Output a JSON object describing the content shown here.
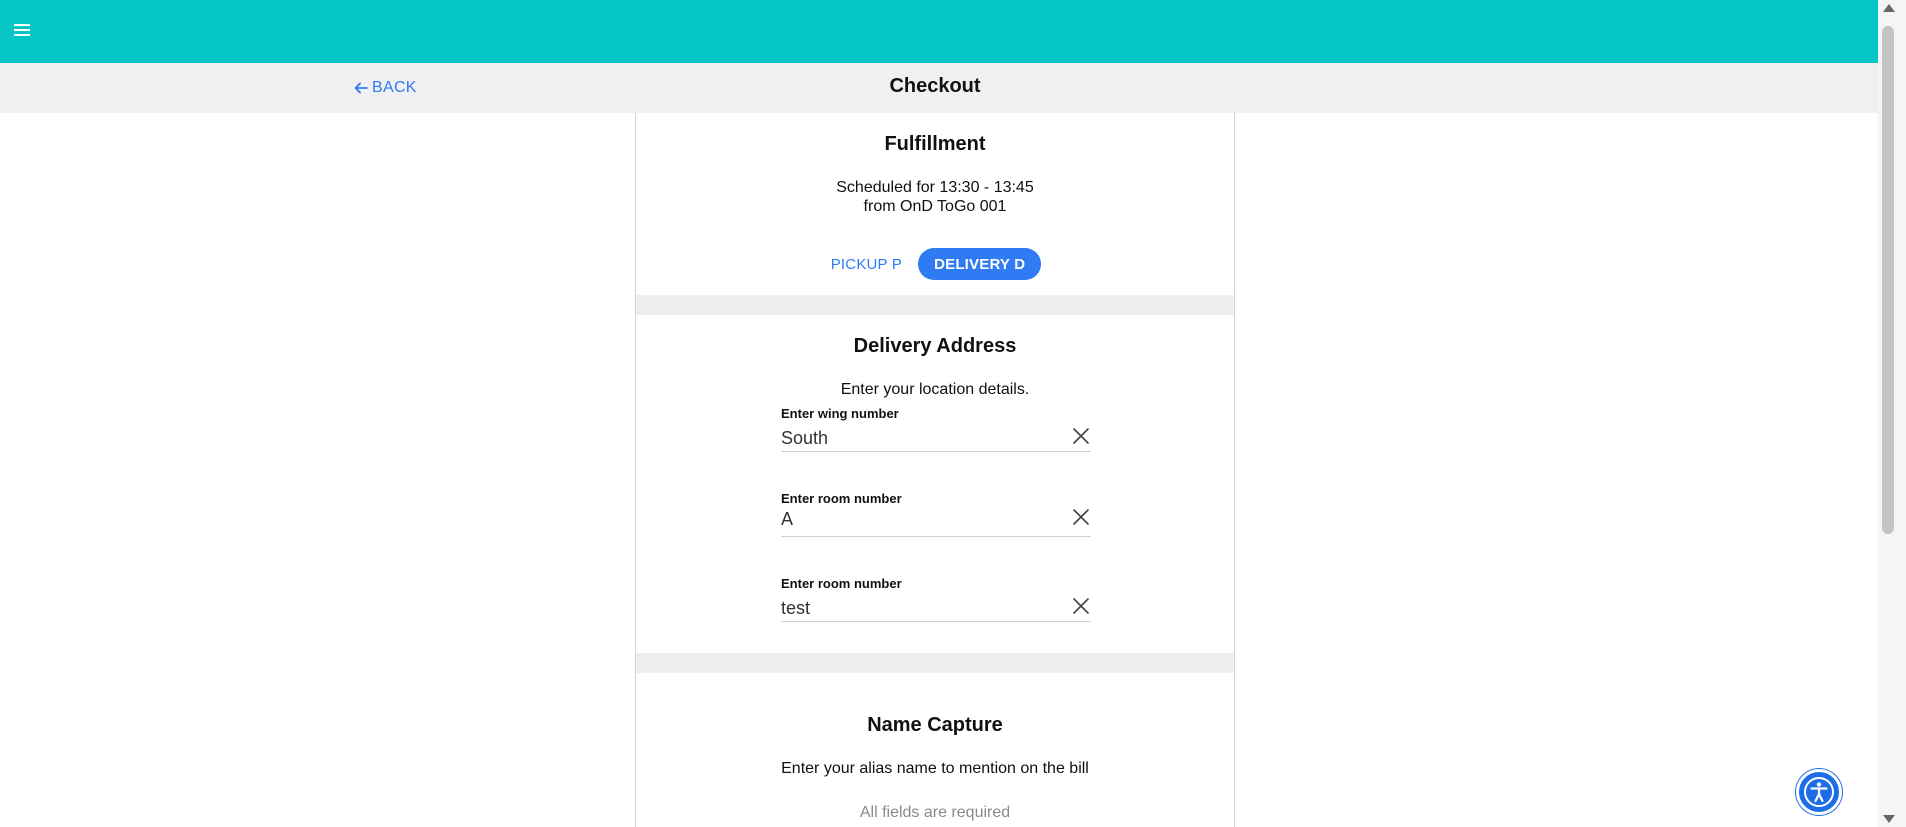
{
  "header": {
    "menu_icon": "hamburger-icon",
    "background_color": "#05c5c5"
  },
  "subheader": {
    "back_label": "BACK",
    "back_icon": "arrow-left-icon",
    "title": "Checkout"
  },
  "fulfillment": {
    "title": "Fulfillment",
    "schedule_line1": "Scheduled for 13:30 - 13:45",
    "schedule_line2": "from OnD ToGo 001",
    "options": [
      {
        "label": "PICKUP P",
        "selected": false
      },
      {
        "label": "DELIVERY D",
        "selected": true
      }
    ],
    "accent_color": "#2f7bf3"
  },
  "delivery_address": {
    "title": "Delivery Address",
    "subtitle": "Enter your location details.",
    "fields": [
      {
        "label": "Enter wing number",
        "value": "South"
      },
      {
        "label": "Enter room number",
        "value": "A"
      },
      {
        "label": "Enter room number",
        "value": "test"
      }
    ],
    "clear_icon": "close-icon"
  },
  "name_capture": {
    "title": "Name Capture",
    "subtitle": "Enter your alias name to mention on the bill",
    "hint": "All fields are required"
  },
  "accessibility": {
    "icon": "accessibility-icon"
  }
}
